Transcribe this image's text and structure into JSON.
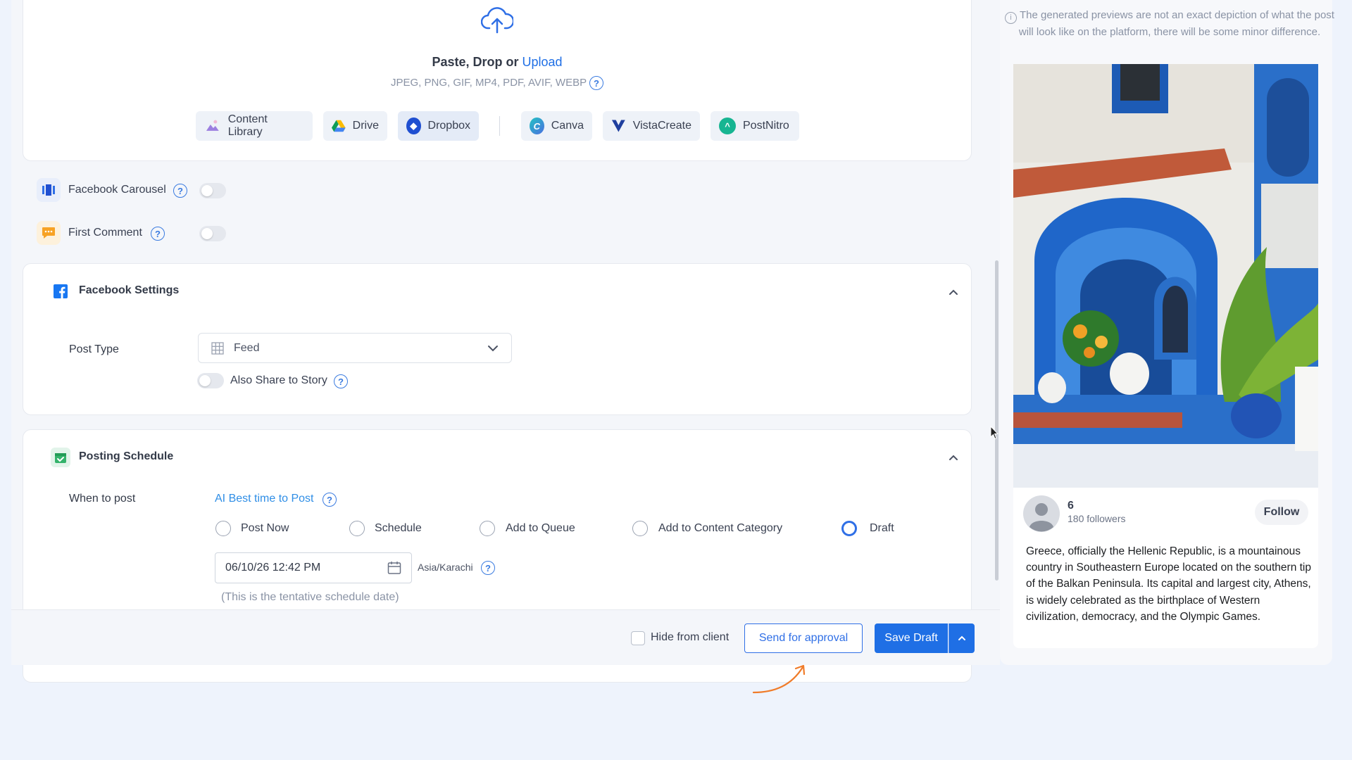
{
  "upload": {
    "paste_text": "Paste, Drop or",
    "upload_link": "Upload",
    "formats": "JPEG, PNG, GIF, MP4, PDF, AVIF, WEBP",
    "sources": [
      "Content Library",
      "Drive",
      "Dropbox",
      "Canva",
      "VistaCreate",
      "PostNitro"
    ]
  },
  "options": {
    "carousel_label": "Facebook Carousel",
    "first_comment_label": "First Comment"
  },
  "facebook_settings": {
    "title": "Facebook Settings",
    "post_type_label": "Post Type",
    "post_type_value": "Feed",
    "story_label": "Also Share to Story"
  },
  "schedule": {
    "title": "Posting Schedule",
    "when_label": "When to post",
    "ai_link": "AI Best time to Post",
    "options": [
      "Post Now",
      "Schedule",
      "Add to Queue",
      "Add to Content Category",
      "Draft"
    ],
    "selected": "Draft",
    "date_value": "06/10/26 12:42 PM",
    "timezone": "Asia/Karachi",
    "tentative_note": "(This is the tentative schedule date)"
  },
  "footer": {
    "hide_label": "Hide from client",
    "approval_button": "Send for approval",
    "save_button": "Save Draft"
  },
  "preview": {
    "disclaimer": "The generated previews are not an exact depiction of what the post will look like on the platform, there will be some minor difference.",
    "account_name": "6",
    "followers": "180 followers",
    "follow_button": "Follow",
    "post_text": "Greece, officially the Hellenic Republic, is a mountainous country in Southeastern Europe located on the southern tip of the Balkan Peninsula. Its capital and largest city, Athens, is widely celebrated as the birthplace of Western civilization, democracy, and the Olympic Games."
  },
  "colors": {
    "accent": "#1f6fe5",
    "background": "#eef3fc",
    "arrow": "#f07c2a"
  }
}
